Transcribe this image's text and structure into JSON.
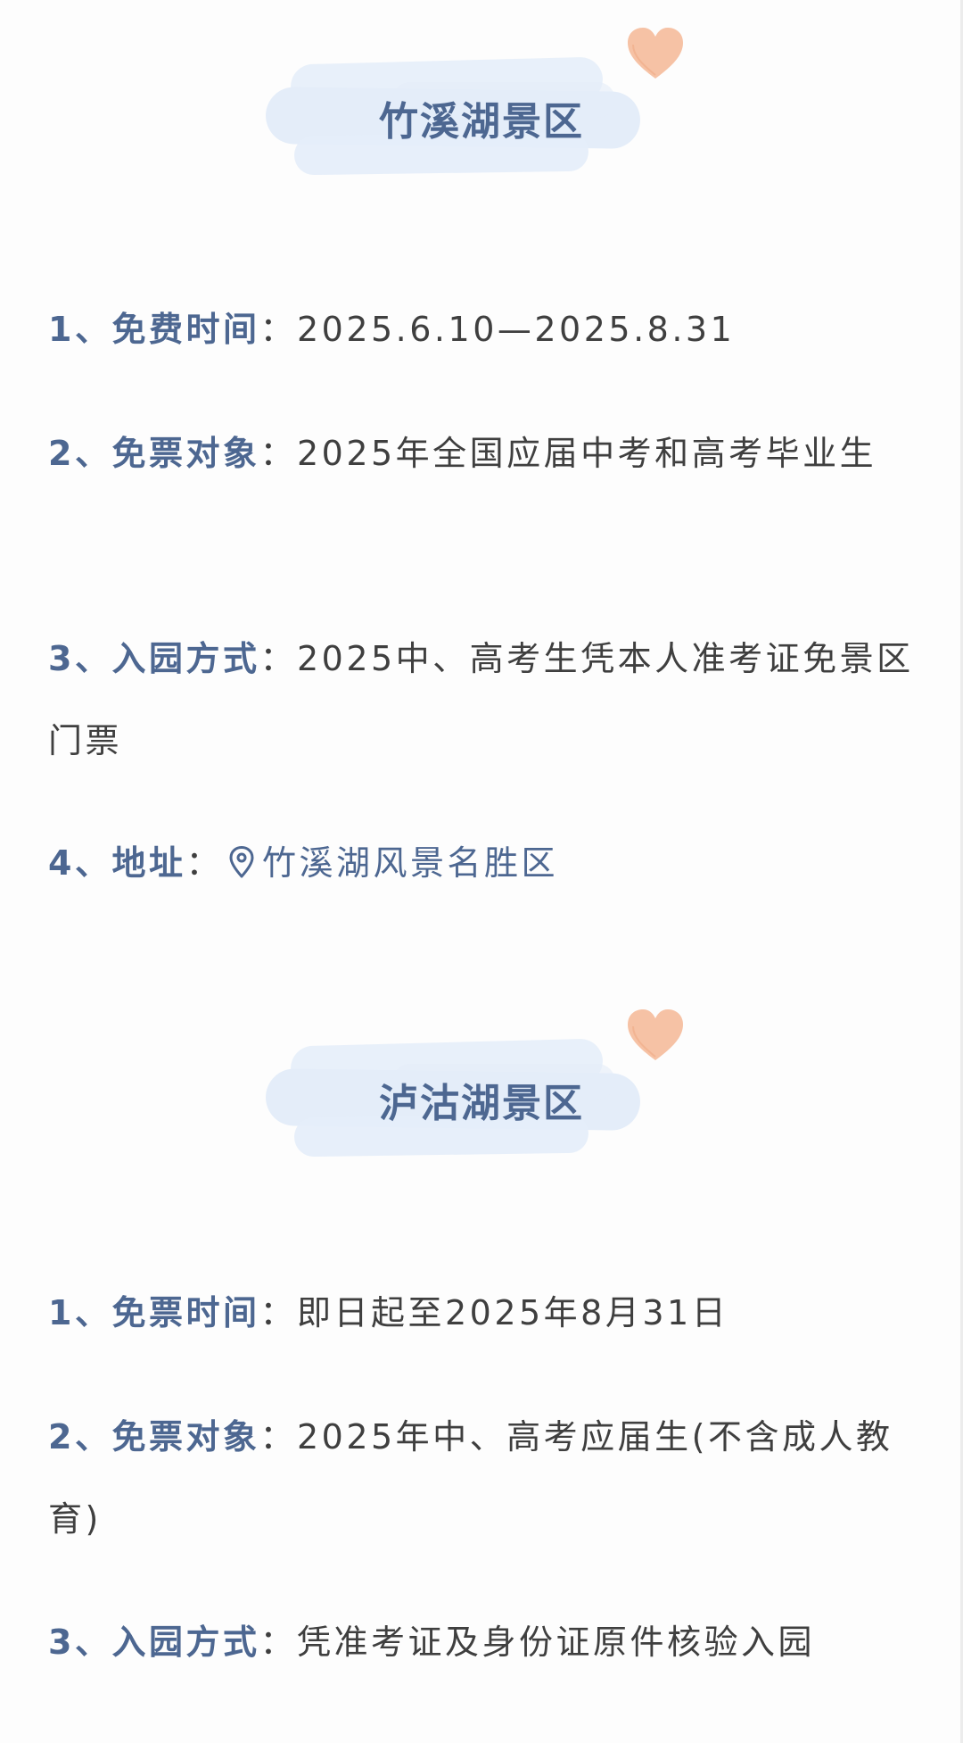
{
  "sections": [
    {
      "title": "竹溪湖景区",
      "items": [
        {
          "label": "1、免费时间",
          "sep": "：",
          "value": "2025.6.10—2025.8.31"
        },
        {
          "label": "2、免票对象",
          "sep": "：",
          "value": "2025年全国应届中考和高考毕业生"
        },
        {
          "label": "3、入园方式",
          "sep": "：",
          "value": "2025中、高考生凭本人准考证免景区门票"
        },
        {
          "label": "4、地址",
          "sep": "：",
          "value": "竹溪湖风景名胜区",
          "icon": "location-pin-icon"
        }
      ]
    },
    {
      "title": "泸沽湖景区",
      "items": [
        {
          "label": "1、免票时间",
          "sep": "：",
          "value": "即日起至2025年8月31日"
        },
        {
          "label": "2、免票对象",
          "sep": "：",
          "value": "2025年中、高考应届生(不含成人教育)"
        },
        {
          "label": "3、入园方式",
          "sep": "：",
          "value": "凭准考证及身份证原件核验入园"
        }
      ]
    }
  ],
  "colors": {
    "accent": "#4d6791",
    "text": "#3f3f3f",
    "banner": "#e4edf9",
    "heart": "#f6c2a5"
  }
}
